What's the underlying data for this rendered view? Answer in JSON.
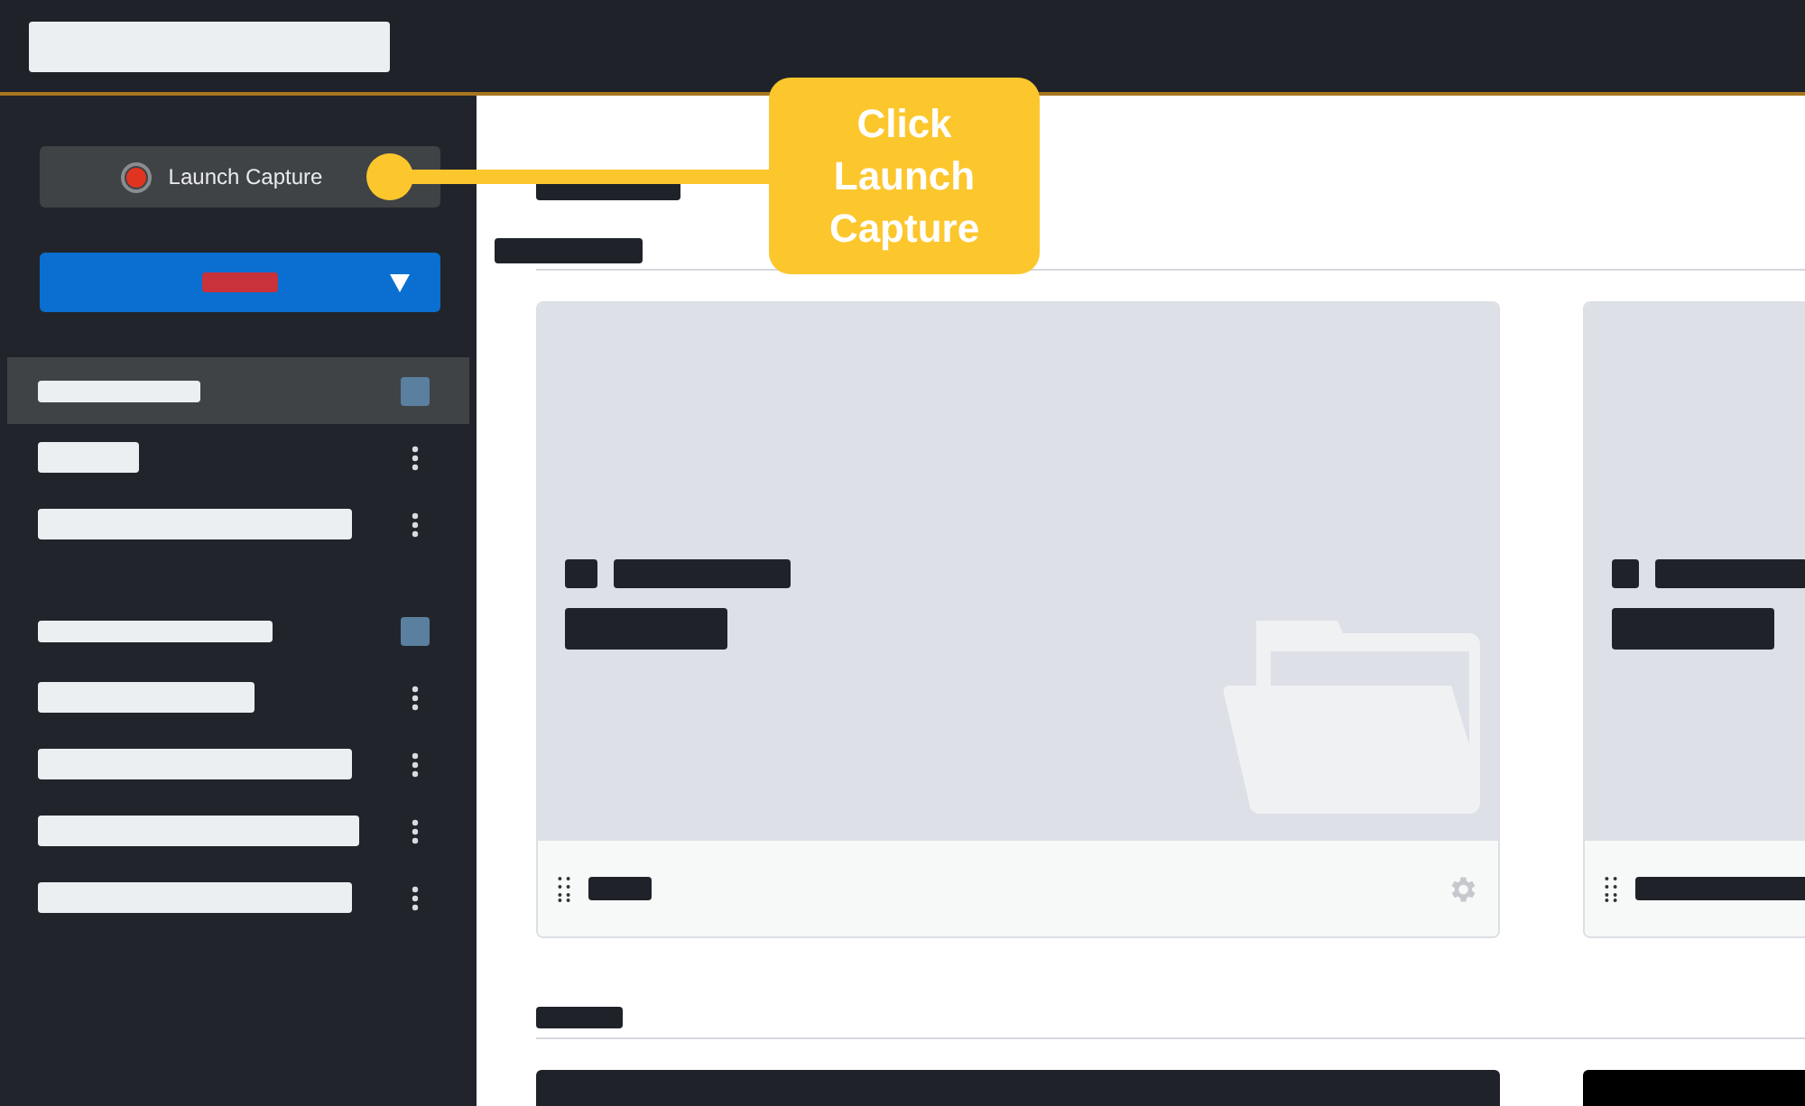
{
  "sidebar": {
    "launch_button": {
      "label": "Launch Capture"
    },
    "items": [
      {
        "kind": "group",
        "selected": true
      },
      {
        "kind": "item",
        "selected": false
      },
      {
        "kind": "item",
        "selected": false
      },
      {
        "kind": "group",
        "selected": false
      },
      {
        "kind": "item",
        "selected": false
      },
      {
        "kind": "item",
        "selected": false
      },
      {
        "kind": "item",
        "selected": false
      },
      {
        "kind": "item",
        "selected": false
      }
    ]
  },
  "callout": {
    "text": "Click Launch Capture"
  }
}
